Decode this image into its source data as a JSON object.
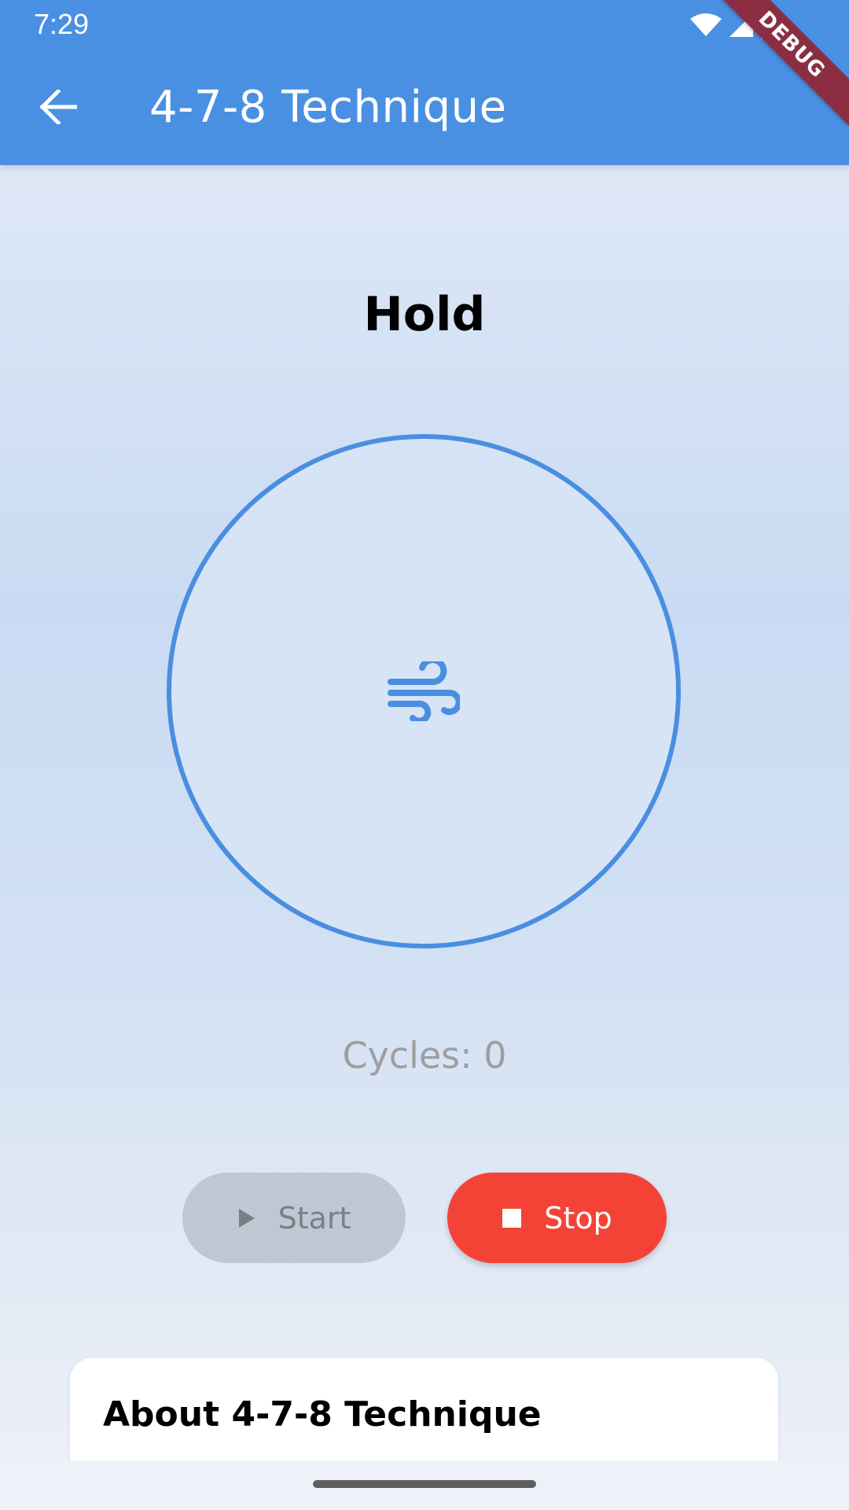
{
  "status_bar": {
    "time": "7:29"
  },
  "app_bar": {
    "title": "4-7-8 Technique",
    "back_icon": "arrow-left-icon"
  },
  "debug_banner": {
    "label": "DEBUG"
  },
  "breathing": {
    "phase": "Hold",
    "center_icon": "wind-icon",
    "cycles_label": "Cycles: 0"
  },
  "controls": {
    "start_label": "Start",
    "start_icon": "play-icon",
    "start_enabled": false,
    "stop_label": "Stop",
    "stop_icon": "stop-icon"
  },
  "about_card": {
    "title": "About 4-7-8 Technique"
  },
  "colors": {
    "primary": "#4a90e2",
    "stop": "#f44336",
    "disabled": "#bdc8d4"
  }
}
